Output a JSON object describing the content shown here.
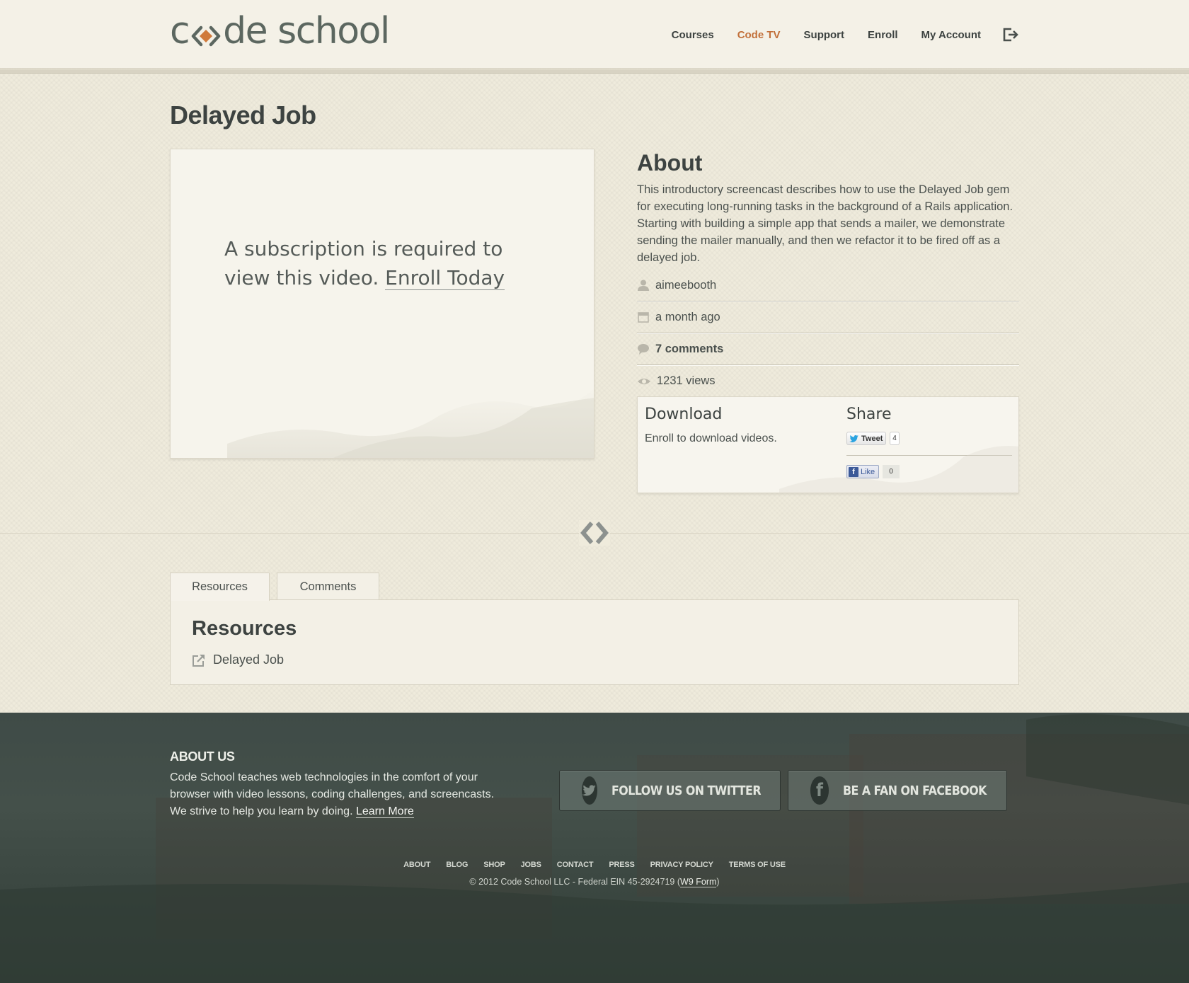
{
  "header": {
    "logo_text_left": "c",
    "logo_text_right": "de school",
    "nav": [
      {
        "label": "Courses",
        "active": false
      },
      {
        "label": "Code TV",
        "active": true
      },
      {
        "label": "Support",
        "active": false
      },
      {
        "label": "Enroll",
        "active": false
      },
      {
        "label": "My Account",
        "active": false
      }
    ],
    "signout_icon": "sign-out-icon"
  },
  "page": {
    "title": "Delayed Job"
  },
  "video": {
    "message": "A subscription is required to view this video.",
    "enroll_link": "Enroll Today"
  },
  "about": {
    "title": "About",
    "description": "This introductory screencast describes how to use the Delayed Job gem for executing long-running tasks in the background of a Rails application. Starting with building a simple app that sends a mailer, we demonstrate sending the mailer manually, and then we refactor it to be fired off as a delayed job.",
    "author": "aimeebooth",
    "posted": "a month ago",
    "comments": "7 comments",
    "views": "1231 views"
  },
  "download": {
    "title": "Download",
    "text": "Enroll to download videos."
  },
  "share": {
    "title": "Share",
    "tweet_label": "Tweet",
    "tweet_count": "4",
    "like_label": "Like",
    "like_count": "0"
  },
  "tabs": [
    {
      "label": "Resources",
      "active": true
    },
    {
      "label": "Comments",
      "active": false
    }
  ],
  "resources": {
    "title": "Resources",
    "items": [
      {
        "label": "Delayed Job"
      }
    ]
  },
  "footer": {
    "about_title": "ABOUT US",
    "about_text": "Code School teaches web technologies in the comfort of your browser with video lessons, coding challenges, and screencasts. We strive to help you learn by doing.",
    "learn_more": "Learn More",
    "twitter_button": "FOLLOW US ON TWITTER",
    "facebook_button": "BE A FAN ON FACEBOOK",
    "links": [
      "ABOUT",
      "BLOG",
      "SHOP",
      "JOBS",
      "CONTACT",
      "PRESS",
      "PRIVACY POLICY",
      "TERMS OF USE"
    ],
    "copyright": "© 2012 Code School LLC - Federal EIN 45-2924719 (",
    "w9_link": "W9 Form",
    "copyright_end": ")"
  },
  "colors": {
    "accent": "#c2703a",
    "text": "#3d4341",
    "background": "#efebdc",
    "footer": "#3f4b47"
  }
}
